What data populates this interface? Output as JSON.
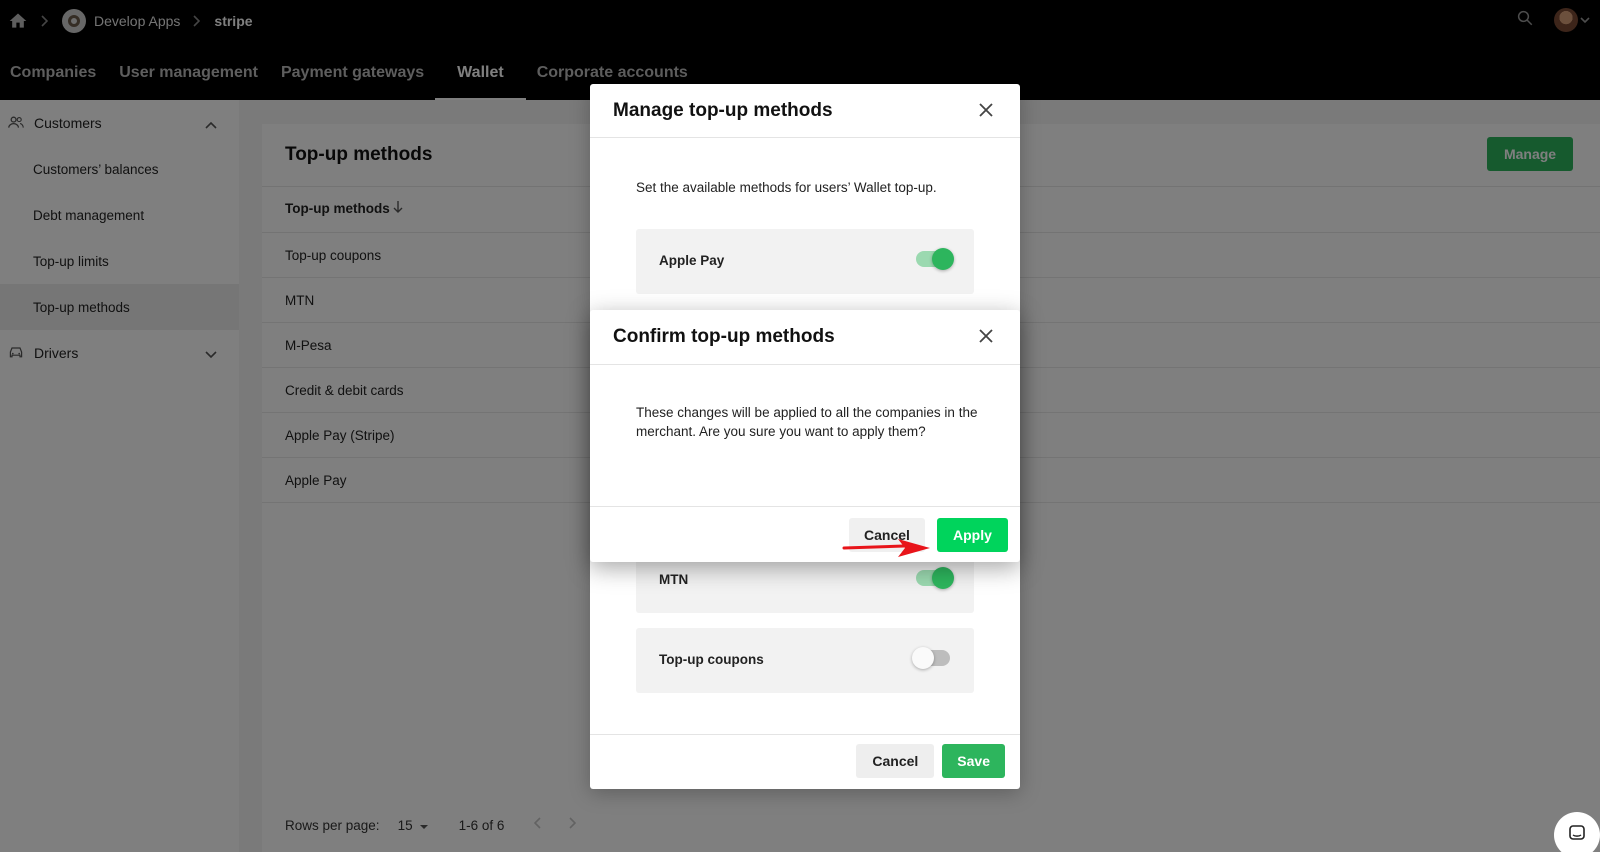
{
  "breadcrumb": {
    "app": "Develop Apps",
    "current": "stripe"
  },
  "nav_tabs": [
    {
      "label": "Companies"
    },
    {
      "label": "User management"
    },
    {
      "label": "Payment gateways"
    },
    {
      "label": "Wallet"
    },
    {
      "label": "Corporate accounts"
    }
  ],
  "sidebar": {
    "customers_label": "Customers",
    "items": [
      {
        "label": "Customers’ balances"
      },
      {
        "label": "Debt management"
      },
      {
        "label": "Top-up limits"
      },
      {
        "label": "Top-up methods"
      }
    ],
    "drivers_label": "Drivers"
  },
  "main": {
    "title": "Top-up methods",
    "manage_label": "Manage",
    "column_header": "Top-up methods",
    "rows": [
      "Top-up coupons",
      "MTN",
      "M-Pesa",
      "Credit & debit cards",
      "Apple Pay (Stripe)",
      "Apple Pay"
    ],
    "pagination": {
      "rows_per_page_label": "Rows per page:",
      "rows_per_page": "15",
      "range": "1-6 of 6"
    }
  },
  "manage_modal": {
    "title": "Manage top-up methods",
    "description": "Set the available methods for users’ Wallet top-up.",
    "methods": [
      {
        "label": "Apple Pay",
        "enabled": true
      },
      {
        "label": "MTN",
        "enabled": true
      },
      {
        "label": "Top-up coupons",
        "enabled": false
      }
    ],
    "cancel_label": "Cancel",
    "save_label": "Save"
  },
  "confirm_modal": {
    "title": "Confirm top-up methods",
    "message": "These changes will be applied to all the companies in the merchant. Are you sure you want to apply them?",
    "cancel_label": "Cancel",
    "apply_label": "Apply"
  },
  "colors": {
    "primary_green": "#2db55d",
    "apply_green": "#00d45c",
    "annotation_arrow": "#e8141a"
  }
}
